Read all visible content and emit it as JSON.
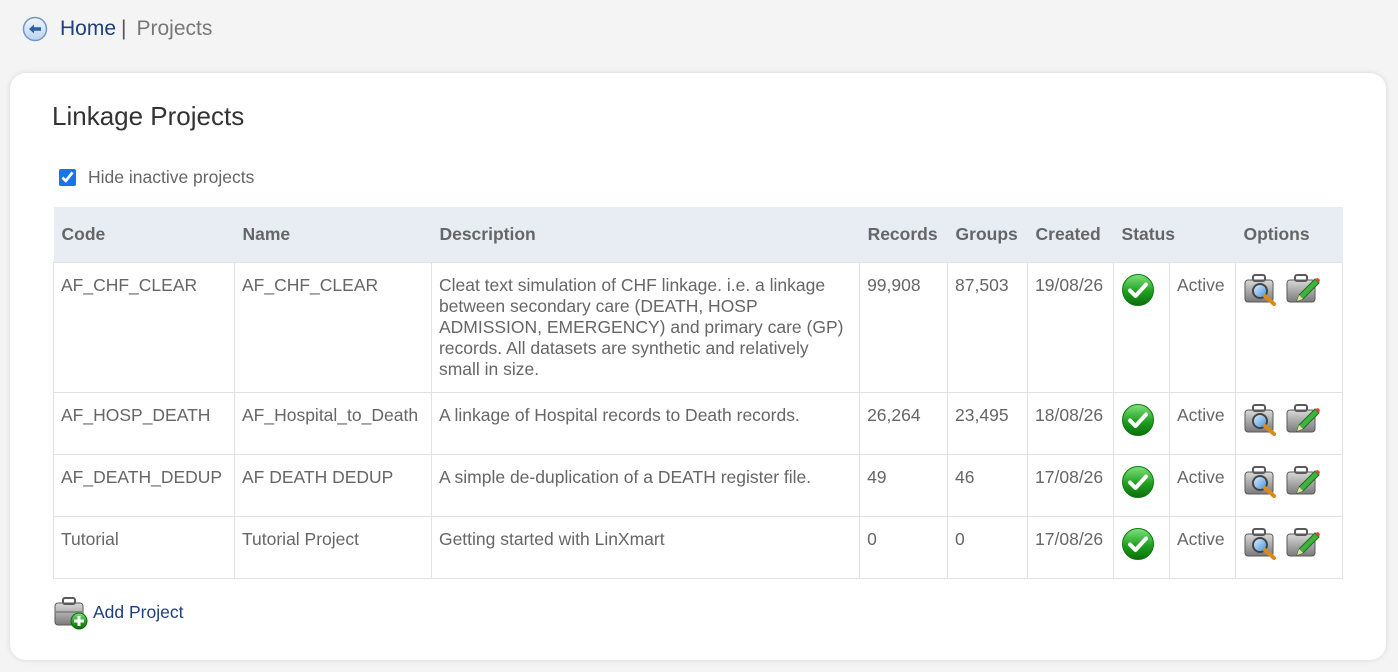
{
  "breadcrumb": {
    "home": "Home",
    "separator": "|",
    "current": "Projects"
  },
  "page": {
    "title": "Linkage Projects",
    "hide_inactive_label": "Hide inactive projects",
    "hide_inactive_checked": true
  },
  "table": {
    "headers": {
      "code": "Code",
      "name": "Name",
      "description": "Description",
      "records": "Records",
      "groups": "Groups",
      "created": "Created",
      "status": "Status",
      "options": "Options"
    },
    "rows": [
      {
        "code": "AF_CHF_CLEAR",
        "name": "AF_CHF_CLEAR",
        "description": "Cleat text simulation of CHF linkage. i.e. a linkage between secondary care (DEATH, HOSP ADMISSION, EMERGENCY) and primary care (GP) records. All datasets are synthetic and relatively small in size.",
        "records": "99,908",
        "groups": "87,503",
        "created": "19/08/26",
        "status": "Active"
      },
      {
        "code": "AF_HOSP_DEATH",
        "name": "AF_Hospital_to_Death",
        "description": "A linkage of Hospital records to Death records.",
        "records": "26,264",
        "groups": "23,495",
        "created": "18/08/26",
        "status": "Active"
      },
      {
        "code": "AF_DEATH_DEDUP",
        "name": "AF DEATH DEDUP",
        "description": "A simple de-duplication of a DEATH register file.",
        "records": "49",
        "groups": "46",
        "created": "17/08/26",
        "status": "Active"
      },
      {
        "code": "Tutorial",
        "name": "Tutorial Project",
        "description": "Getting started with LinXmart",
        "records": "0",
        "groups": "0",
        "created": "17/08/26",
        "status": "Active"
      }
    ]
  },
  "footer": {
    "add_project_label": "Add Project"
  },
  "icons": {
    "back": "back-arrow-icon",
    "status": "checkmark-icon",
    "view": "magnifier-icon",
    "edit": "pencil-icon",
    "add": "add-icon"
  },
  "colors": {
    "link": "#1f3f7a",
    "header_bg": "#e8edf4",
    "status_green": "#1fa01f"
  }
}
